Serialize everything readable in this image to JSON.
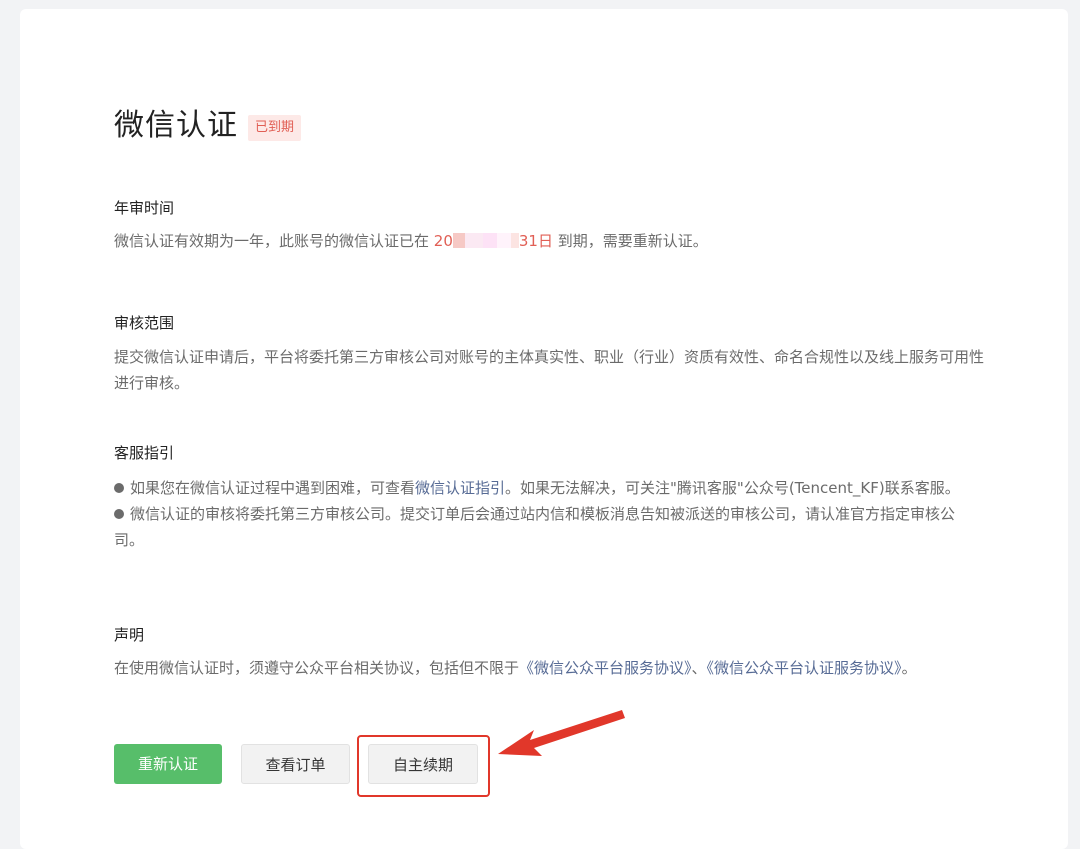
{
  "page": {
    "title": "微信认证",
    "status_badge": "已到期"
  },
  "sections": {
    "annual_review": {
      "title": "年审时间",
      "text_before": "微信认证有效期为一年，此账号的微信认证已在 ",
      "date_start": "20",
      "date_end": "31日",
      "text_after": " 到期，需要重新认证。"
    },
    "review_scope": {
      "title": "审核范围",
      "text": "提交微信认证申请后，平台将委托第三方审核公司对账号的主体真实性、职业（行业）资质有效性、命名合规性以及线上服务可用性进行审核。"
    },
    "support_guide": {
      "title": "客服指引",
      "item1_before": "如果您在微信认证过程中遇到困难，可查看",
      "item1_link": "微信认证指引",
      "item1_after": "。如果无法解决，可关注\"腾讯客服\"公众号(Tencent_KF)联系客服。",
      "item2": "微信认证的审核将委托第三方审核公司。提交订单后会通过站内信和模板消息告知被派送的审核公司，请认准官方指定审核公司。"
    },
    "statement": {
      "title": "声明",
      "text_before": "在使用微信认证时，须遵守公众平台相关协议，包括但不限于",
      "link1": "《微信公众平台服务协议》",
      "separator": "、",
      "link2": "《微信公众平台认证服务协议》",
      "text_after": "。"
    }
  },
  "actions": {
    "reauth_label": "重新认证",
    "view_orders_label": "查看订单",
    "self_renew_label": "自主续期"
  },
  "colors": {
    "accent_green": "#57be6a",
    "warning_red": "#e15f55",
    "link_blue": "#576b95",
    "annotation_red": "#e1372a"
  },
  "icons": {
    "annotation": "red-arrow-icon",
    "bullet": "bullet-dot-icon"
  }
}
